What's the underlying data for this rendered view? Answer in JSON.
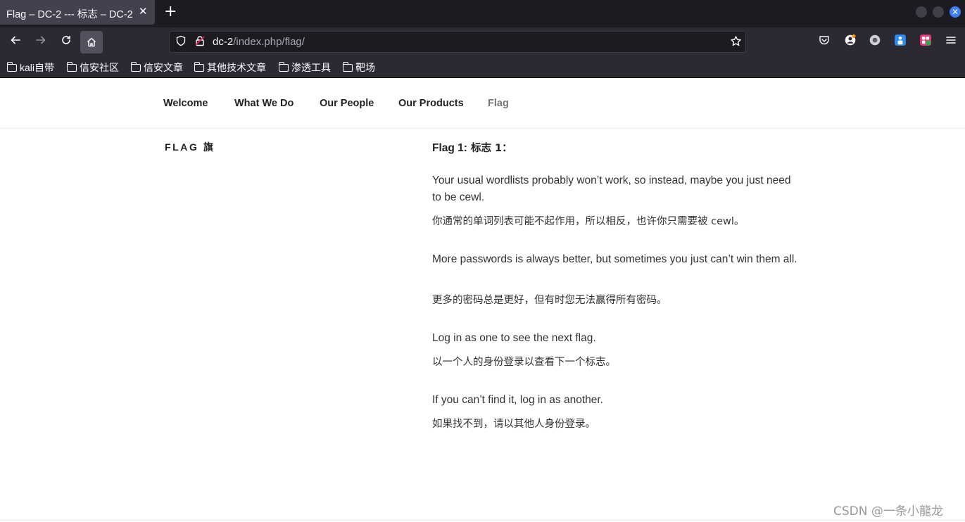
{
  "browser": {
    "tab_title": "Flag – DC-2 --- 标志 – DC-2",
    "tab_close": "✕",
    "new_tab": "+",
    "url_host": "dc-2",
    "url_path": "/index.php/flag/",
    "icons": [
      "back-icon",
      "forward-icon",
      "reload-icon",
      "home-icon",
      "shield-icon",
      "insecure-lock-icon",
      "star-icon",
      "pocket-icon",
      "account-icon",
      "extension-icon",
      "translate-icon",
      "menu-icon"
    ],
    "bookmarks": [
      "kali自带",
      "信安社区",
      "信安文章",
      "其他技术文章",
      "渗透工具",
      "靶场"
    ]
  },
  "site": {
    "nav": [
      "Welcome",
      "What We Do",
      "Our People",
      "Our Products",
      "Flag"
    ],
    "page_title": "FLAG 旗",
    "flag_heading_en": "Flag 1:",
    "flag_heading_zh": " 标志 1：",
    "paragraphs": [
      {
        "en": "Your usual wordlists probably won’t work, so instead, maybe you just need to be cewl.",
        "zh": "你通常的单词列表可能不起作用，所以相反，也许你只需要被 cewl。"
      },
      {
        "en": "More passwords is always better, but sometimes you just can’t win them all.",
        "zh": "更多的密码总是更好，但有时您无法赢得所有密码。"
      },
      {
        "en": "Log in as one to see the next flag.",
        "zh": "以一个人的身份登录以查看下一个标志。"
      },
      {
        "en": "If you can’t find it, log in as another.",
        "zh": "如果找不到，请以其他人身份登录。"
      }
    ],
    "watermark": "CSDN @一条小龍龙"
  },
  "colors": {
    "tabbar_bg": "#1c1b22",
    "toolbar_bg": "#2b2a33",
    "accent_blue": "#3d7ef8",
    "nav_current": "#767676"
  }
}
